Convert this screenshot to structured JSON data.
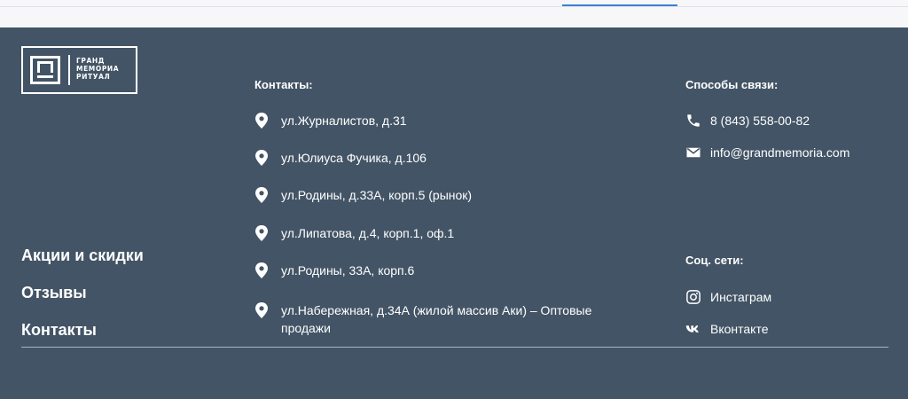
{
  "logo": {
    "lines": [
      "ГРАНД",
      "МЕМОРИА",
      "РИТУАЛ"
    ]
  },
  "nav": {
    "items": [
      "Акции и скидки",
      "Отзывы",
      "Контакты"
    ]
  },
  "contacts": {
    "title": "Контакты:",
    "addresses": [
      "ул.Журналистов, д.31",
      "ул.Юлиуса Фучика, д.106",
      "ул.Родины, д.33А, корп.5 (рынок)",
      "ул.Липатова, д.4, корп.1, оф.1",
      "ул.Родины, 33А, корп.6",
      "ул.Набережная, д.34А (жилой массив Аки) – Оптовые продажи"
    ]
  },
  "ways": {
    "title": "Способы связи:",
    "phone": "8 (843) 558-00-82",
    "email": "info@grandmemoria.com"
  },
  "social": {
    "title": "Соц. сети:",
    "instagram": "Инстаграм",
    "vk": "Вконтакте"
  },
  "colors": {
    "footer_bg": "#435466",
    "accent_tab": "#3b82d6"
  },
  "icons": {
    "address": "map-pin-icon",
    "phone": "phone-icon",
    "email": "envelope-icon",
    "instagram": "instagram-icon",
    "vk": "vk-icon"
  }
}
